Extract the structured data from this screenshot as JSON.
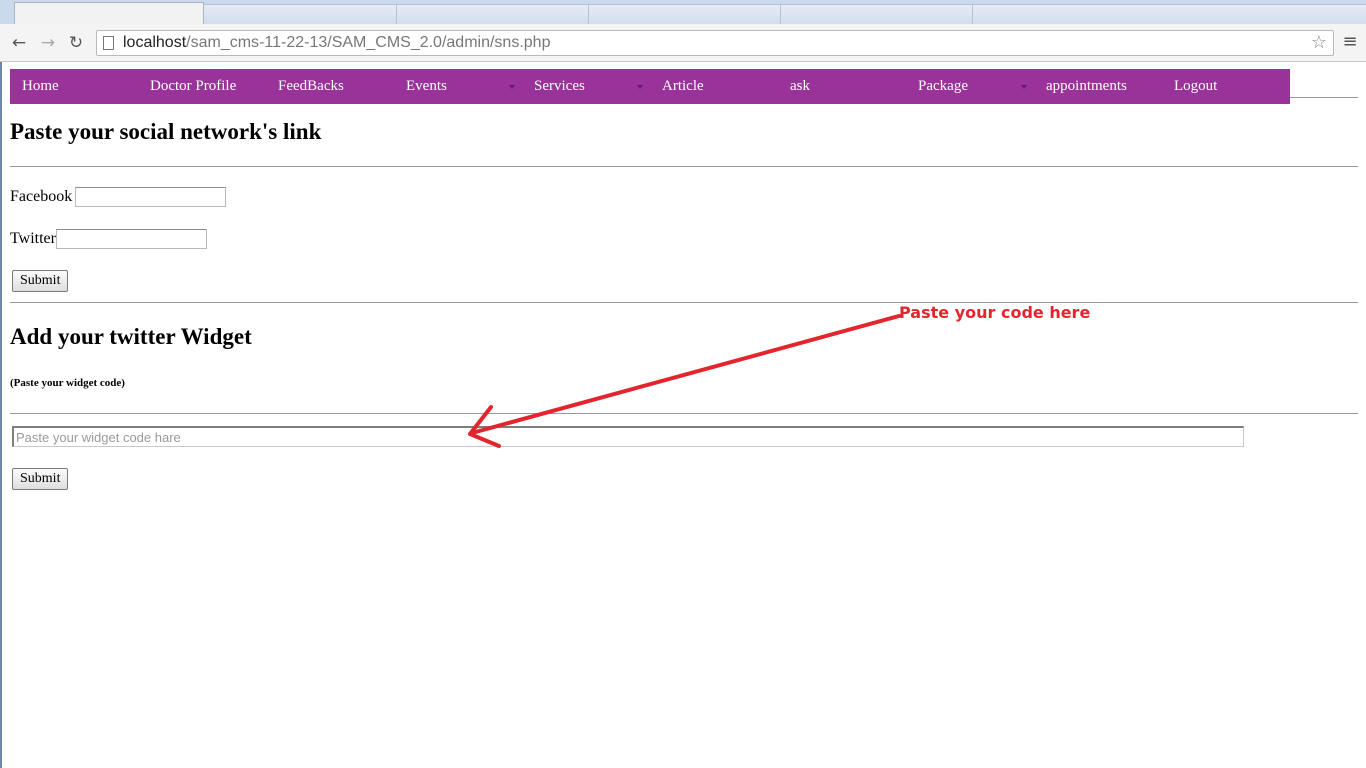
{
  "browser": {
    "url_host": "localhost",
    "url_path": "/sam_cms-11-22-13/SAM_CMS_2.0/admin/sns.php",
    "icons": {
      "back": "arrow-back-icon",
      "forward": "arrow-forward-icon",
      "reload": "reload-icon",
      "page": "page-icon",
      "bookmark": "star-icon",
      "menu": "hamburger-menu-icon"
    }
  },
  "nav": {
    "color": "#993399",
    "items": [
      {
        "label": "Home"
      },
      {
        "label": "Doctor Profile"
      },
      {
        "label": "FeedBacks"
      },
      {
        "label": "Events"
      },
      {
        "label": "Services"
      },
      {
        "label": "Article"
      },
      {
        "label": "ask"
      },
      {
        "label": "Package"
      },
      {
        "label": "appointments"
      },
      {
        "label": "Logout"
      }
    ]
  },
  "social": {
    "heading": "Paste your social network's link",
    "facebook_label": "Facebook",
    "facebook_value": "",
    "twitter_label": "Twitter",
    "twitter_value": "",
    "submit_label": "Submit"
  },
  "widget": {
    "heading": "Add your twitter Widget",
    "note": "(Paste your widget code)",
    "placeholder": "Paste your widget code hare",
    "value": "",
    "submit_label": "Submit"
  },
  "annotation": {
    "text": "Paste your  code here",
    "color": "#e3262d"
  }
}
